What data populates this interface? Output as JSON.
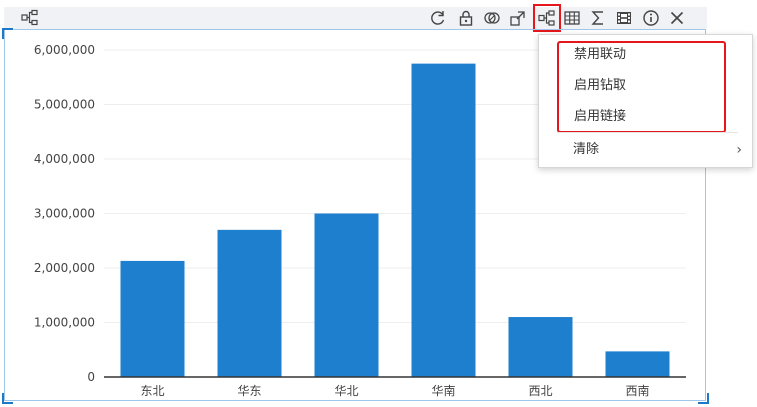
{
  "toolbar": {
    "left_icon": "linkage-icon",
    "buttons": [
      {
        "name": "refresh-button",
        "icon": "refresh-icon",
        "x": 428
      },
      {
        "name": "lock-button",
        "icon": "lock-icon",
        "x": 456
      },
      {
        "name": "overlay-button",
        "icon": "overlap-circles-icon",
        "x": 482
      },
      {
        "name": "resize-button",
        "icon": "resize-boxes-icon",
        "x": 508
      },
      {
        "name": "linkage-button",
        "icon": "linkage-icon",
        "x": 536,
        "active": true
      },
      {
        "name": "table-button",
        "icon": "table-grid-icon",
        "x": 562
      },
      {
        "name": "sum-button",
        "icon": "sigma-icon",
        "x": 588
      },
      {
        "name": "film-button",
        "icon": "filmstrip-icon",
        "x": 614
      },
      {
        "name": "info-button",
        "icon": "info-icon",
        "x": 641
      },
      {
        "name": "close-button",
        "icon": "close-icon",
        "x": 667
      }
    ]
  },
  "menu": {
    "items": [
      {
        "label": "禁用联动",
        "name": "menu-disable-linkage"
      },
      {
        "label": "启用钻取",
        "name": "menu-enable-drill"
      },
      {
        "label": "启用链接",
        "name": "menu-enable-link"
      }
    ],
    "clear_label": "清除",
    "clear_arrow": "›"
  },
  "colors": {
    "bar": "#1e7fcf",
    "highlight": "#e5161c",
    "grid": "#eeeeee",
    "axis": "#333333"
  },
  "chart_data": {
    "type": "bar",
    "categories": [
      "东北",
      "华东",
      "华北",
      "华南",
      "西北",
      "西南"
    ],
    "values": [
      2130000,
      2700000,
      3000000,
      5750000,
      1100000,
      470000
    ],
    "ylim": [
      0,
      6000000
    ],
    "yticks": [
      0,
      1000000,
      2000000,
      3000000,
      4000000,
      5000000,
      6000000
    ],
    "ytick_labels": [
      "0",
      "1,000,000",
      "2,000,000",
      "3,000,000",
      "4,000,000",
      "5,000,000",
      "6,000,000"
    ],
    "grid": true,
    "legend": "none"
  }
}
